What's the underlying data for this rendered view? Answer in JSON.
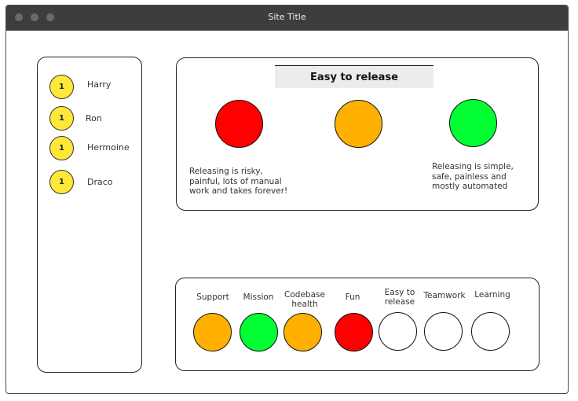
{
  "window": {
    "title": "Site Title"
  },
  "colors": {
    "red": "#ff0000",
    "amber": "#ffb000",
    "green": "#00ff33",
    "none": "#ffffff",
    "avatar": "#ffe838"
  },
  "people": [
    {
      "name": "Harry",
      "badge": "1"
    },
    {
      "name": "Ron",
      "badge": "1"
    },
    {
      "name": "Hermoine",
      "badge": "1"
    },
    {
      "name": "Draco",
      "badge": "1"
    }
  ],
  "detail": {
    "title": "Easy to release",
    "scale": [
      "red",
      "amber",
      "green"
    ],
    "red_text": "Releasing is risky, painful, lots of manual work and takes forever!",
    "green_text": "Releasing is simple, safe, painless and mostly automated"
  },
  "metrics": [
    {
      "label": "Support",
      "status": "amber"
    },
    {
      "label": "Mission",
      "status": "green"
    },
    {
      "label": "Codebase health",
      "status": "amber"
    },
    {
      "label": "Fun",
      "status": "red"
    },
    {
      "label": "Easy to release",
      "status": "none"
    },
    {
      "label": "Teamwork",
      "status": "none"
    },
    {
      "label": "Learning",
      "status": "none"
    }
  ]
}
